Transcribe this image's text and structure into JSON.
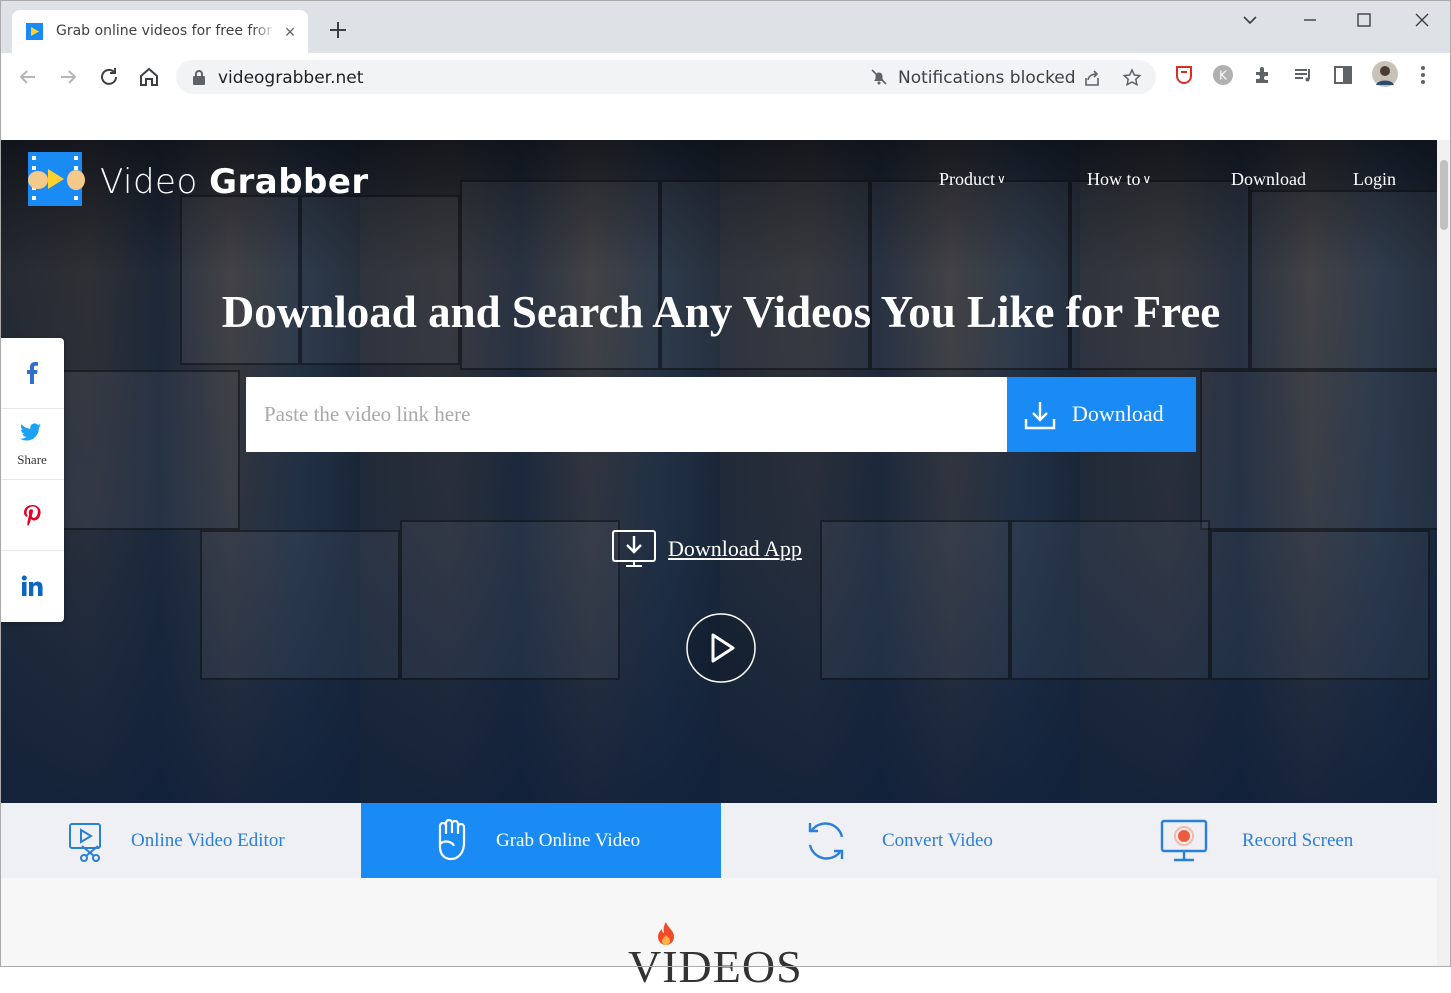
{
  "browser": {
    "tab_title": "Grab online videos for free from",
    "url": "videograbber.net",
    "notifications_status": "Notifications blocked",
    "icons": [
      "back-icon",
      "forward-icon",
      "reload-icon",
      "home-icon",
      "lock-icon",
      "notification-blocked-icon",
      "share-icon",
      "star-icon",
      "extension-icons",
      "profile-avatar",
      "menu-icon"
    ]
  },
  "site": {
    "logo_light": "Video ",
    "logo_bold": "Grabber",
    "nav": {
      "product": "Product",
      "how_to": "How to",
      "download": "Download",
      "login": "Login"
    },
    "hero_title": "Download and Search Any Videos You Like for Free",
    "search": {
      "placeholder": "Paste the video link here",
      "button_label": "Download"
    },
    "download_app": "Download App",
    "share": {
      "twitter_label": "Share"
    },
    "features": [
      {
        "label": "Online Video Editor"
      },
      {
        "label": "Grab Online Video"
      },
      {
        "label": "Convert Video"
      },
      {
        "label": "Record Screen"
      }
    ],
    "section_title": "VIDEOS",
    "colors": {
      "accent": "#1a8bf5",
      "feature_text": "#2a7fd8",
      "hero_overlay": "#14233a"
    }
  }
}
